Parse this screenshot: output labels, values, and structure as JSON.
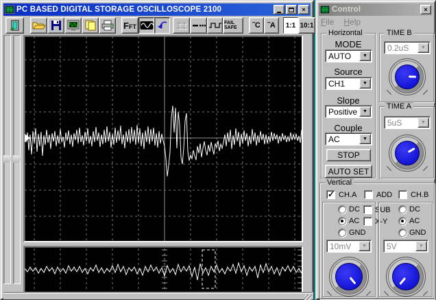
{
  "main_window": {
    "title": "PC BASED DIGITAL STORAGE OSCILLOSCOPE 2100",
    "toolbar": {
      "fft": "FFT",
      "fail_safe": "FAIL SAFE",
      "temp_c": "˜C",
      "temp_a": "˜A",
      "ratio_11": "1:1",
      "ratio_101": "10:1"
    }
  },
  "control_window": {
    "title": "Control",
    "menu": {
      "file": "File",
      "help": "Help"
    },
    "horizontal": {
      "label": "Horizontal",
      "mode_label": "MODE",
      "mode_value": "AUTO",
      "source_label": "Source",
      "source_value": "CH1",
      "slope_label": "Slope",
      "slope_value": "Positive",
      "couple_label": "Couple",
      "couple_value": "AC",
      "stop_label": "STOP",
      "autoset_label": "AUTO SET"
    },
    "time_b": {
      "label": "TIME B",
      "value": "0.2uS"
    },
    "time_a": {
      "label": "TIME A",
      "value": "5uS"
    },
    "vertical": {
      "label": "Vertical",
      "checkboxes": {
        "cha": {
          "label": "CH.A",
          "checked": true
        },
        "add": {
          "label": "ADD",
          "checked": false
        },
        "chb": {
          "label": "CH.B",
          "checked": false
        },
        "sub": {
          "label": "SUB",
          "checked": false
        },
        "xy": {
          "label": "X-Y",
          "checked": false
        }
      },
      "cha_coupling": {
        "options": [
          "DC",
          "AC",
          "GND"
        ],
        "selected": "AC"
      },
      "chb_coupling": {
        "options": [
          "DC",
          "AC",
          "GND"
        ],
        "selected": "AC"
      },
      "cha_range": "10mV",
      "chb_range": "5V"
    }
  },
  "scope": {
    "main_wave": [
      3,
      -6,
      8,
      -18,
      5,
      -24,
      10,
      -8,
      14,
      -20,
      6,
      -12,
      9,
      -26,
      4,
      -10,
      12,
      -7,
      5,
      -16,
      7,
      -5,
      10,
      -12,
      4,
      -8,
      13,
      -6,
      2,
      -14,
      8,
      -4,
      11,
      -9,
      5,
      -13,
      7,
      -3,
      12,
      -8,
      15,
      -6,
      4,
      -11,
      9,
      -5,
      14,
      -8,
      3,
      -12,
      10,
      -6,
      16,
      -4,
      8,
      -13,
      5,
      -9,
      12,
      -7,
      17,
      -5,
      9,
      -14,
      6,
      -10,
      15,
      -7,
      11,
      -4,
      18,
      -9,
      5,
      -15,
      10,
      -6,
      13,
      -8,
      16,
      -5,
      12,
      -10,
      19,
      -7,
      14,
      -12,
      8,
      -16,
      11,
      -6,
      17,
      -9,
      13,
      -5,
      15,
      -11,
      7,
      -14,
      10,
      -8,
      6,
      -4,
      -12,
      -30,
      -56,
      -40,
      -20,
      30,
      47,
      8,
      44,
      -15,
      38,
      20,
      -28,
      -38,
      -15,
      25,
      36,
      -20,
      -33,
      -25,
      -30,
      -18,
      -26,
      -32,
      -12,
      -22,
      -8,
      -28,
      -15,
      -5,
      -18,
      -25,
      -10,
      -20,
      -6,
      -16,
      -24,
      -8,
      -14,
      -4,
      -19,
      -9,
      -15,
      -6,
      5,
      -12,
      8,
      -6,
      12,
      -16,
      4,
      -10,
      14,
      -5,
      9,
      -13,
      6,
      -8,
      11,
      -4,
      7,
      -12,
      3,
      -9,
      13,
      -5,
      8,
      -11,
      4,
      -7,
      10,
      -3,
      6,
      -9,
      5,
      -8,
      3,
      -6,
      9,
      -4,
      7,
      -2,
      5,
      -8,
      3,
      -5,
      7,
      -3,
      4,
      -6,
      2,
      -5,
      8,
      -3,
      5,
      -2,
      6,
      -4,
      3,
      -7,
      12
    ],
    "small_wave": [
      2,
      -3,
      4,
      -2,
      3,
      -5,
      2,
      -4,
      5,
      -2,
      3,
      -6,
      4,
      -3,
      2,
      -5,
      6,
      -2,
      4,
      -3,
      5,
      -4,
      2,
      -6,
      3,
      -2,
      7,
      -4,
      3,
      -5,
      2,
      -3,
      6,
      -4,
      8,
      -3,
      5,
      -7,
      3,
      -2,
      4,
      -6,
      2,
      -8,
      5,
      -3,
      7,
      -2,
      4,
      -5,
      3,
      -9,
      6,
      -4,
      2,
      -7,
      8,
      -3,
      5,
      -2,
      6,
      -10,
      4,
      -15,
      9,
      -5,
      3,
      -8,
      5,
      -3,
      7,
      -4,
      2,
      -6,
      4,
      -2,
      8,
      -5,
      10,
      -3,
      6,
      -8,
      4,
      -2,
      5,
      -12,
      7,
      -4,
      9,
      -3,
      5,
      -6,
      3,
      -8,
      4,
      -2,
      6,
      -3,
      5,
      -4,
      2,
      -5
    ]
  }
}
